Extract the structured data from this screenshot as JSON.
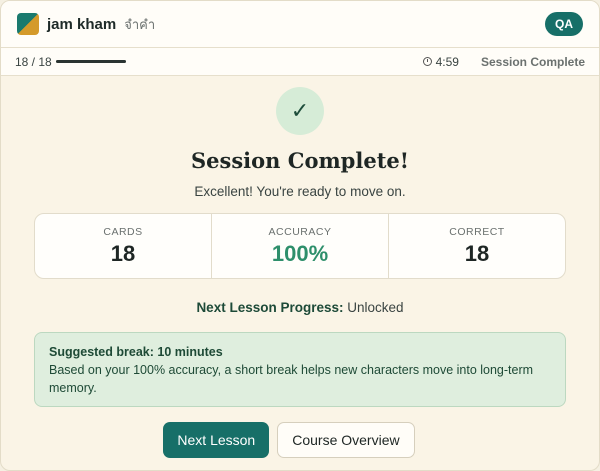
{
  "header": {
    "brand": "jam kham",
    "brand_sub": "จำคำ",
    "badge": "QA"
  },
  "status": {
    "count": "18 / 18",
    "progress_fraction": 1.0,
    "timer": "4:59",
    "label": "Session Complete"
  },
  "main": {
    "check_glyph": "✓",
    "title": "Session Complete!",
    "subtitle": "Excellent! You're ready to move on.",
    "stats": [
      {
        "label": "CARDS",
        "value": "18"
      },
      {
        "label": "ACCURACY",
        "value": "100%"
      },
      {
        "label": "CORRECT",
        "value": "18"
      }
    ],
    "next_progress_label": "Next Lesson Progress:",
    "next_progress_value": "Unlocked",
    "break": {
      "title": "Suggested break: 10 minutes",
      "body": "Based on your 100% accuracy, a short break helps new characters move into long-term memory."
    },
    "buttons": {
      "primary": "Next Lesson",
      "secondary": "Course Overview"
    }
  },
  "colors": {
    "accent": "#176f68",
    "success": "#2e8f6b",
    "background": "#faf4e6"
  }
}
